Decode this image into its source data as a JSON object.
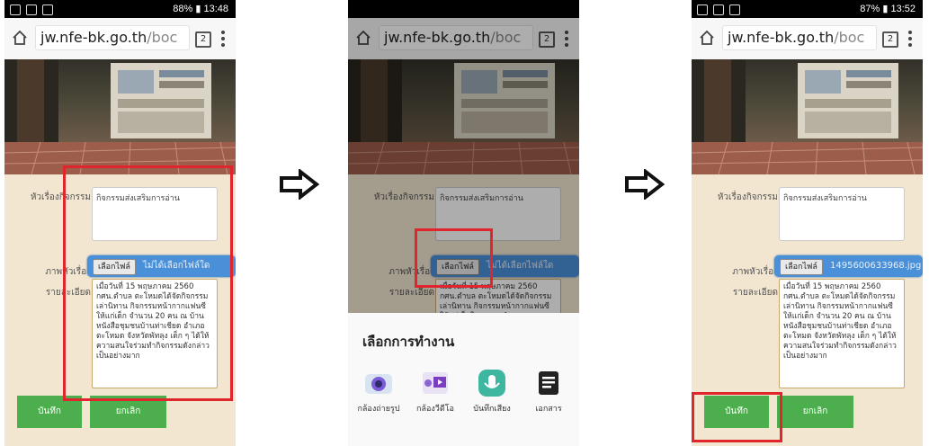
{
  "phone1": {
    "status": {
      "right": "88% ▮ 13:48"
    },
    "url": {
      "main": "jw.nfe-bk.go.th",
      "dim": "/boc",
      "tabs": "2"
    },
    "form": {
      "title_label": "หัวเรื่องกิจกรรม",
      "title_value": "กิจกรรมส่งเสริมการอ่าน",
      "image_label": "ภาพหัวเรื่อง",
      "file_button": "เลือกไฟล์",
      "file_status": "ไม่ได้เลือกไฟล์ใด",
      "detail_label": "รายละเอียด",
      "detail_value": "เมื่อวันที่ 15 พฤษภาคม 2560 กศน.ตำบล ตะโหมดได้จัดกิจกรรม เล่านิทาน กิจกรรมหน้ากากแฟนซี ให้แก่เด็ก จำนวน 20 คน ณ บ้านหนังสือชุมชนบ้านท่าเชียด อำเภอตะโหมด จังหวัดพัทลุง เด็ก ๆ ได้ให้ความสนใจร่วมทำกิจกรรมดังกล่าวเป็นอย่างมาก",
      "save": "บันทึก",
      "cancel": "ยกเลิก"
    }
  },
  "phone2": {
    "url": {
      "main": "jw.nfe-bk.go.th",
      "dim": "/boc",
      "tabs": "2"
    },
    "form": {
      "title_label": "หัวเรื่องกิจกรรม",
      "title_value": "กิจกรรมส่งเสริมการอ่าน",
      "image_label": "ภาพหัวเรื่อง",
      "file_button": "เลือกไฟล์",
      "file_status": "ไม่ได้เลือกไฟล์ใด",
      "detail_label": "รายละเอียด",
      "detail_value": "เมื่อวันที่ 15 พฤษภาคม 2560 กศน.ตำบล ตะโหมดได้จัดกิจกรรมเล่านิทาน กิจกรรมหน้ากากแฟนซีให้แก่เด็กในชุมชน จำนวน"
    },
    "sheet": {
      "title": "เลือกการทำงาน",
      "items": [
        "กล้องถ่ายรูป",
        "กล้องวีดีโอ",
        "บันทึกเสียง",
        "เอกสาร"
      ]
    }
  },
  "phone3": {
    "status": {
      "right": "87% ▮ 13:52"
    },
    "url": {
      "main": "jw.nfe-bk.go.th",
      "dim": "/boc",
      "tabs": "2"
    },
    "form": {
      "title_label": "หัวเรื่องกิจกรรม",
      "title_value": "กิจกรรมส่งเสริมการอ่าน",
      "image_label": "ภาพหัวเรื่อง",
      "file_button": "เลือกไฟล์",
      "file_status": "1495600633968.jpg",
      "detail_label": "รายละเอียด",
      "detail_value": "เมื่อวันที่ 15 พฤษภาคม 2560 กศน.ตำบล ตะโหมดได้จัดกิจกรรม เล่านิทาน กิจกรรมหน้ากากแฟนซี ให้แก่เด็ก จำนวน 20 คน ณ บ้านหนังสือชุมชนบ้านท่าเชียด อำเภอตะโหมด จังหวัดพัทลุง เด็ก ๆ ได้ให้ความสนใจร่วมทำกิจกรรมดังกล่าวเป็นอย่างมาก",
      "save": "บันทึก",
      "cancel": "ยกเลิก"
    }
  },
  "colors": {
    "highlight": "#e0262c",
    "button_green": "#4cae4c",
    "file_row_blue": "#4a90d9",
    "form_bg": "#f2e6d0"
  },
  "icons": [
    "home-icon",
    "tab-switcher-icon",
    "overflow-menu-icon",
    "right-arrow-icon",
    "camera-icon",
    "video-camera-icon",
    "voice-recorder-icon",
    "document-icon"
  ]
}
